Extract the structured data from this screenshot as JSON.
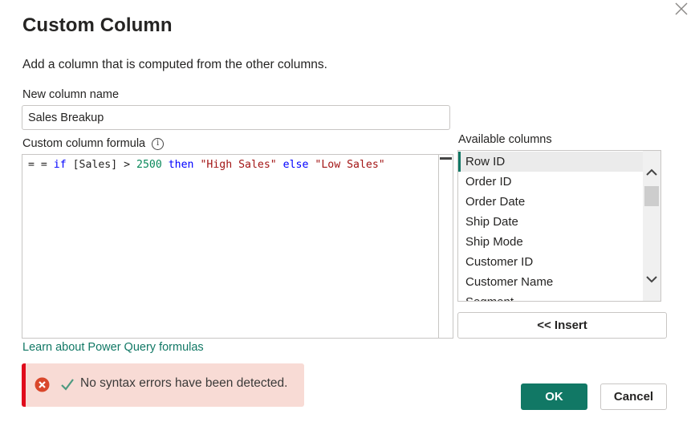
{
  "dialog": {
    "title": "Custom Column",
    "subtitle": "Add a column that is computed from the other columns.",
    "close_icon": "close-icon"
  },
  "name_field": {
    "label": "New column name",
    "value": "Sales Breakup"
  },
  "formula": {
    "label": "Custom column formula",
    "info_icon": "info-icon",
    "tokens": [
      {
        "type": "op",
        "text": "= = "
      },
      {
        "type": "kw",
        "text": "if"
      },
      {
        "type": "op",
        "text": " [Sales] > "
      },
      {
        "type": "num",
        "text": "2500"
      },
      {
        "type": "op",
        "text": " "
      },
      {
        "type": "kw",
        "text": "then"
      },
      {
        "type": "op",
        "text": " "
      },
      {
        "type": "str",
        "text": "\"High Sales\""
      },
      {
        "type": "op",
        "text": " "
      },
      {
        "type": "kw",
        "text": "else"
      },
      {
        "type": "op",
        "text": " "
      },
      {
        "type": "str",
        "text": "\"Low Sales\""
      }
    ],
    "full_text": "= = if [Sales] > 2500 then \"High Sales\" else \"Low Sales\""
  },
  "available_columns": {
    "label": "Available columns",
    "selected_index": 0,
    "items": [
      "Row ID",
      "Order ID",
      "Order Date",
      "Ship Date",
      "Ship Mode",
      "Customer ID",
      "Customer Name",
      "Segment"
    ],
    "insert_label": "<< Insert"
  },
  "learn_link": "Learn about Power Query formulas",
  "status": {
    "text": "No syntax errors have been detected.",
    "error_icon": "error-circle-icon",
    "check_icon": "checkmark-icon",
    "accent_color": "#e00b1c",
    "background_color": "#f8dbd5"
  },
  "buttons": {
    "ok": "OK",
    "cancel": "Cancel",
    "primary_color": "#117865"
  }
}
